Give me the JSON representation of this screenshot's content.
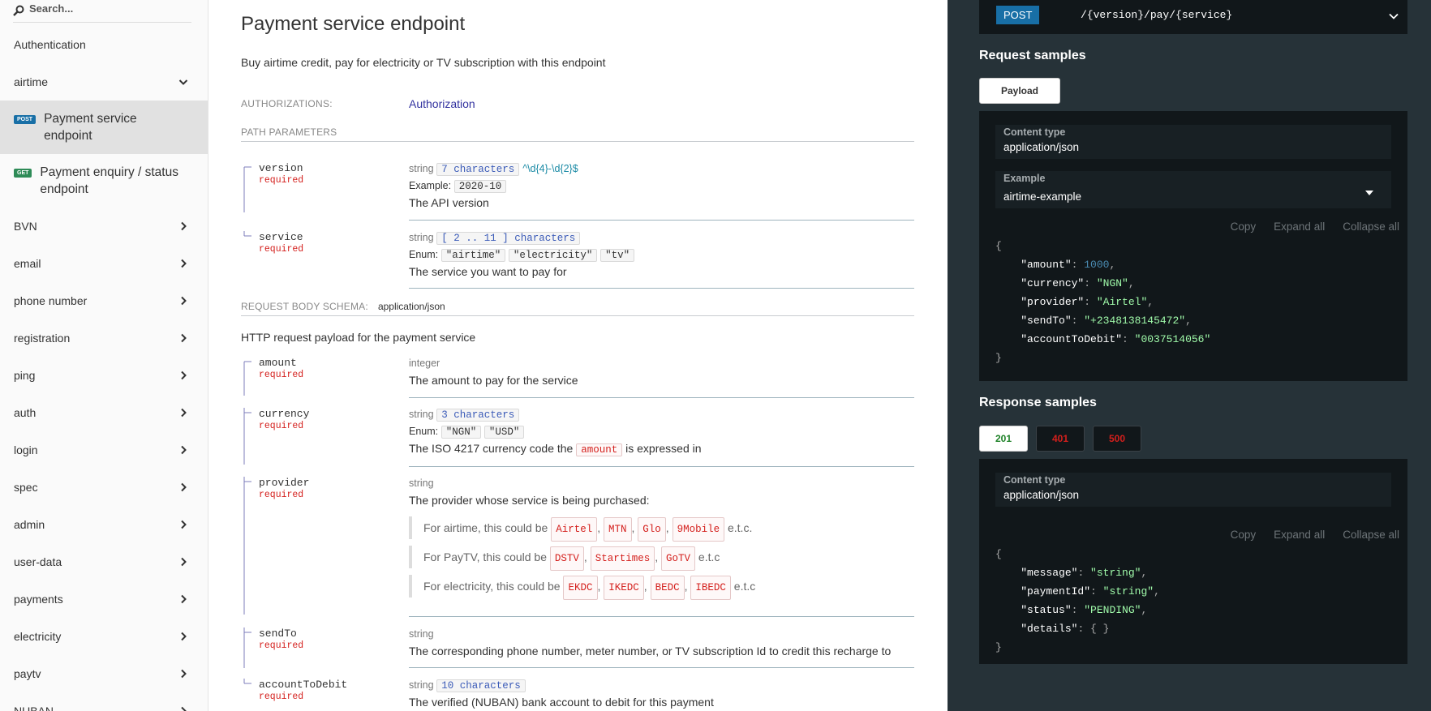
{
  "sidebar": {
    "search_placeholder": "Search...",
    "items": [
      {
        "label": "Authentication"
      },
      {
        "label": "airtime"
      },
      {
        "label": "BVN"
      },
      {
        "label": "email"
      },
      {
        "label": "phone number"
      },
      {
        "label": "registration"
      },
      {
        "label": "ping"
      },
      {
        "label": "auth"
      },
      {
        "label": "login"
      },
      {
        "label": "spec"
      },
      {
        "label": "admin"
      },
      {
        "label": "user-data"
      },
      {
        "label": "payments"
      },
      {
        "label": "electricity"
      },
      {
        "label": "paytv"
      },
      {
        "label": "NUBAN"
      }
    ],
    "ops": [
      {
        "method": "POST",
        "label": "Payment service endpoint"
      },
      {
        "method": "GET",
        "label": "Payment enquiry / status endpoint"
      }
    ]
  },
  "main": {
    "title": "Payment service endpoint",
    "description": "Buy airtime credit, pay for electricity or TV subscription with this endpoint",
    "authorizations_label": "AUTHORIZATIONS:",
    "authorization": "Authorization",
    "path_params_label": "PATH PARAMETERS",
    "path_params": {
      "version": {
        "name": "version",
        "required": "required",
        "type": "string",
        "constraint": "7 characters",
        "pattern": "^\\d{4}-\\d{2}$",
        "example_label": "Example:",
        "example": "2020-10",
        "desc": "The API version"
      },
      "service": {
        "name": "service",
        "required": "required",
        "type": "string",
        "constraint": "[ 2 .. 11 ] characters",
        "enum_label": "Enum:",
        "enum": [
          "\"airtime\"",
          "\"electricity\"",
          "\"tv\""
        ],
        "desc": "The service you want to pay for"
      }
    },
    "body_schema_label": "REQUEST BODY SCHEMA:",
    "body_schema_type": "application/json",
    "body_desc": "HTTP request payload for the payment service",
    "body_params": {
      "amount": {
        "name": "amount",
        "required": "required",
        "type": "integer",
        "desc": "The amount to pay for the service"
      },
      "currency": {
        "name": "currency",
        "required": "required",
        "type": "string",
        "constraint": "3 characters",
        "enum_label": "Enum:",
        "enum": [
          "\"NGN\"",
          "\"USD\""
        ],
        "desc_pre": "The ISO 4217 currency code the",
        "desc_code": "amount",
        "desc_post": "is expressed in"
      },
      "provider": {
        "name": "provider",
        "required": "required",
        "type": "string",
        "desc": "The provider whose service is being purchased:",
        "airtime_pre": "For airtime, this could be",
        "airtime": [
          "Airtel",
          "MTN",
          "Glo",
          "9Mobile"
        ],
        "airtime_post": "e.t.c.",
        "paytv_pre": "For PayTV, this could be",
        "paytv": [
          "DSTV",
          "Startimes",
          "GoTV"
        ],
        "paytv_post": "e.t.c",
        "elec_pre": "For electricity, this could be",
        "elec": [
          "EKDC",
          "IKEDC",
          "BEDC",
          "IBEDC"
        ],
        "elec_post": "e.t.c"
      },
      "sendTo": {
        "name": "sendTo",
        "required": "required",
        "type": "string",
        "desc": "The corresponding phone number, meter number, or TV subscription Id to credit this recharge to"
      },
      "accountToDebit": {
        "name": "accountToDebit",
        "required": "required",
        "type": "string",
        "constraint": "10 characters",
        "desc": "The verified (NUBAN) bank account to debit for this payment"
      }
    }
  },
  "right": {
    "method": "POST",
    "path": "/{version}/pay/{service}",
    "request_title": "Request samples",
    "request_tab": "Payload",
    "content_type_label": "Content type",
    "content_type": "application/json",
    "example_label": "Example",
    "example_value": "airtime-example",
    "copy": "Copy",
    "expand": "Expand all",
    "collapse": "Collapse all",
    "request_json": [
      {
        "key": "\"amount\"",
        "value": "1000",
        "kind": "n",
        "comma": ","
      },
      {
        "key": "\"currency\"",
        "value": "\"NGN\"",
        "kind": "s",
        "comma": ","
      },
      {
        "key": "\"provider\"",
        "value": "\"Airtel\"",
        "kind": "s",
        "comma": ","
      },
      {
        "key": "\"sendTo\"",
        "value": "\"+2348138145472\"",
        "kind": "s",
        "comma": ","
      },
      {
        "key": "\"accountToDebit\"",
        "value": "\"0037514056\"",
        "kind": "s",
        "comma": ""
      }
    ],
    "response_title": "Response samples",
    "response_tabs": [
      {
        "label": "201",
        "color": "#1d8127"
      },
      {
        "label": "401",
        "color": "#d41f1c"
      },
      {
        "label": "500",
        "color": "#d41f1c"
      }
    ],
    "response_json": [
      {
        "key": "\"message\"",
        "value": "\"string\"",
        "kind": "s",
        "comma": ","
      },
      {
        "key": "\"paymentId\"",
        "value": "\"string\"",
        "kind": "s",
        "comma": ","
      },
      {
        "key": "\"status\"",
        "value": "\"PENDING\"",
        "kind": "s",
        "comma": ","
      },
      {
        "key": "\"details\"",
        "value": "{ }",
        "kind": "p",
        "comma": ""
      }
    ]
  }
}
